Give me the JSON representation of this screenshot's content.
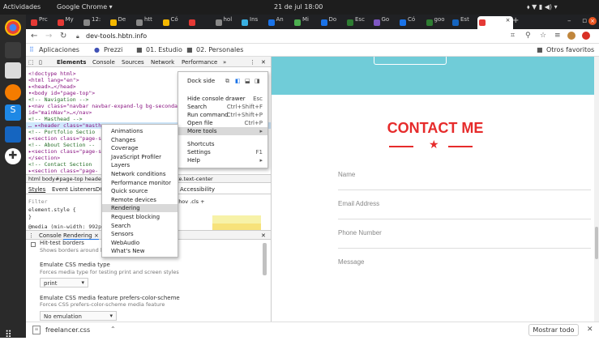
{
  "topbar": {
    "activities": "Actividades",
    "app": "Google Chrome ▾",
    "clock": "21 de jul  18:00"
  },
  "tabs": [
    {
      "label": "Prc",
      "color": "#e53935"
    },
    {
      "label": "My",
      "color": "#e53935"
    },
    {
      "label": "12:",
      "color": "#888"
    },
    {
      "label": "De",
      "color": "#f5b800"
    },
    {
      "label": "htt",
      "color": "#888"
    },
    {
      "label": "Có",
      "color": "#f5b800"
    },
    {
      "label": "",
      "color": "#e53935"
    },
    {
      "label": "hol",
      "color": "#888"
    },
    {
      "label": "Ins",
      "color": "#3ab0e2"
    },
    {
      "label": "An",
      "color": "#1a73e8"
    },
    {
      "label": "Mi",
      "color": "#4caf50"
    },
    {
      "label": "Do",
      "color": "#1a73e8"
    },
    {
      "label": "Esc",
      "color": "#2e7d32"
    },
    {
      "label": "Go",
      "color": "#7e57c2"
    },
    {
      "label": "Có",
      "color": "#1a73e8"
    },
    {
      "label": "goo",
      "color": "#2e7d32"
    },
    {
      "label": "Est",
      "color": "#1565c0"
    },
    {
      "label": "",
      "color": "#e53935"
    }
  ],
  "toolbar": {
    "url": "dev-tools.hbtn.info"
  },
  "bookmarks": {
    "apps": "Aplicaciones",
    "prezzi": "Prezzi",
    "f1": "01. Estudio",
    "f2": "02. Personales",
    "other": "Otros favoritos"
  },
  "devtools": {
    "tabs": [
      "Elements",
      "Console",
      "Sources",
      "Network",
      "Performance",
      "»"
    ],
    "code": [
      "<!doctype html>",
      "<html lang=\"en\">",
      "▸<head>…</head>",
      "▾<body id=\"page-top\">",
      "   <!-- Navigation -->",
      "  ▸<nav class=\"navbar navbar-expand-lg bg-secondar",
      "  id=\"mainNav\">…</nav>",
      "   <!-- Masthead -->",
      "… ▸<header class=\"masthe",
      "   <!-- Portfolio Sectio",
      "  ▸<section class=\"page-s",
      "   <!-- About Section --",
      "  ▸<section class=\"page-s",
      "   </section>",
      "   <!-- Contact Section",
      "  ▸<section class=\"page-"
    ],
    "breadcrumb": "html  body#page-top  heade",
    "breadcrumb_tail": "te.text-center",
    "styles_tabs": [
      "Styles",
      "Event Listeners",
      "DO",
      "Accessibility"
    ],
    "filter": "Filter",
    "filter_tools": ":hov  .cls  +",
    "element_style": "element.style {",
    "media": "@media (min-width: 992px)",
    "drawer_tabs": [
      "Console",
      "Rendering ×"
    ],
    "hit_test_title": "Hit-test borders",
    "hit_test_desc": "Shows borders around hit-test",
    "emulate_media_title": "Emulate CSS media type",
    "emulate_media_desc": "Forces media type for testing print and screen styles",
    "emulate_media_value": "print",
    "scheme_title": "Emulate CSS media feature prefers-color-scheme",
    "scheme_desc": "Forces CSS prefers-color-scheme media feature",
    "scheme_value": "No emulation"
  },
  "menu_main": {
    "dock_side": "Dock side",
    "items": [
      {
        "label": "Hide console drawer",
        "shortcut": "Esc"
      },
      {
        "label": "Search",
        "shortcut": "Ctrl+Shift+F"
      },
      {
        "label": "Run command",
        "shortcut": "Ctrl+Shift+P"
      },
      {
        "label": "Open file",
        "shortcut": "Ctrl+P"
      },
      {
        "label": "More tools",
        "shortcut": "▸"
      },
      {
        "label": "Shortcuts",
        "shortcut": ""
      },
      {
        "label": "Settings",
        "shortcut": "F1"
      },
      {
        "label": "Help",
        "shortcut": "▸"
      }
    ]
  },
  "menu_tools": [
    "Animations",
    "Changes",
    "Coverage",
    "JavaScript Profiler",
    "Layers",
    "Network conditions",
    "Performance monitor",
    "Quick source",
    "Remote devices",
    "Rendering",
    "Request blocking",
    "Search",
    "Sensors",
    "WebAudio",
    "What's New"
  ],
  "page": {
    "heading": "CONTACT ME",
    "fields": [
      "Name",
      "Email Address",
      "Phone Number",
      "Message"
    ]
  },
  "download": {
    "file": "freelancer.css",
    "show_all": "Mostrar todo"
  }
}
